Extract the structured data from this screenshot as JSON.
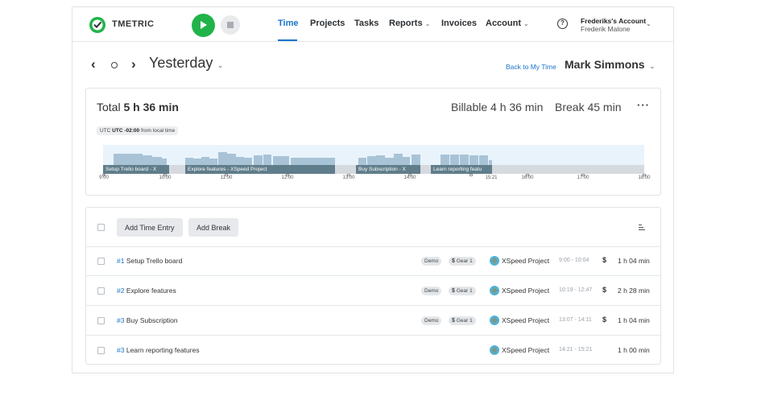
{
  "header": {
    "brand": "TMETRIC",
    "nav": [
      {
        "label": "Time",
        "active": true
      },
      {
        "label": "Projects"
      },
      {
        "label": "Tasks"
      },
      {
        "label": "Reports"
      },
      {
        "label": "Invoices"
      },
      {
        "label": "Account"
      }
    ],
    "account_name": "Frederiks's Account",
    "account_user": "Frederik Malone",
    "help_glyph": "?",
    "colors": {
      "accent": "#1a73c8",
      "play": "#21b34a"
    }
  },
  "date_nav": {
    "prev": "‹",
    "next": "›",
    "date_label": "Yesterday",
    "back_link": "Back to My Time",
    "person": "Mark Simmons"
  },
  "summary": {
    "total_label": "Total",
    "total_value": "5 h 36 min",
    "billable_label": "Billable",
    "billable_value": "4 h 36 min",
    "break_label": "Break",
    "break_value": "45 min",
    "more": "···",
    "utc_value": "UTC -02:00",
    "utc_suffix": "from local time"
  },
  "timeline": {
    "segments": [
      {
        "label": "Setup Trello board - X"
      },
      {
        "label": "Explore features - XSpeed Project"
      },
      {
        "label": "Buy Subscription - X"
      },
      {
        "label": "Learn reporting featu"
      }
    ],
    "ticks": [
      "9:00",
      "10:00",
      "11:00",
      "12:00",
      "13:00",
      "14:00",
      "15:21",
      "16:00",
      "17:00",
      "18:00"
    ]
  },
  "toolbar": {
    "add_time_entry": "Add Time Entry",
    "add_break": "Add Break"
  },
  "entries": [
    {
      "num": "#1",
      "title": "Setup Trello board",
      "tags": [
        "Demo",
        "Gear 1"
      ],
      "project": "XSpeed Project",
      "range": "9:00 - 10:04",
      "billable": "$",
      "duration": "1 h 04 min"
    },
    {
      "num": "#2",
      "title": "Explore features",
      "tags": [
        "Demo",
        "Gear 1"
      ],
      "project": "XSpeed Project",
      "range": "10:19 - 12:47",
      "billable": "$",
      "duration": "2 h 28 min"
    },
    {
      "num": "#3",
      "title": "Buy Subscription",
      "tags": [
        "Demo",
        "Gear 1"
      ],
      "project": "XSpeed Project",
      "range": "13:07 - 14:11",
      "billable": "$",
      "duration": "1 h 04 min"
    },
    {
      "num": "#3",
      "title": "Learn reporting features",
      "tags": [],
      "project": "XSpeed Project",
      "range": "14:21 - 15:21",
      "billable": "",
      "duration": "1 h 00 min"
    }
  ]
}
